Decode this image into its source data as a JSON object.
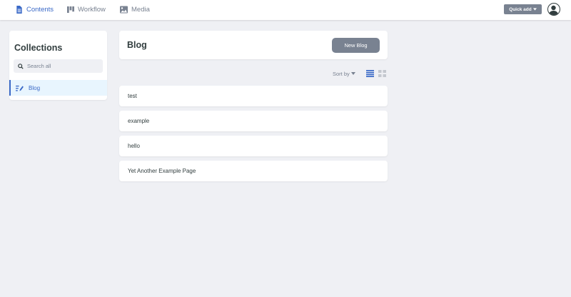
{
  "topbar": {
    "nav": [
      {
        "label": "Contents",
        "icon": "document-icon",
        "active": true
      },
      {
        "label": "Workflow",
        "icon": "kanban-icon",
        "active": false
      },
      {
        "label": "Media",
        "icon": "image-icon",
        "active": false
      }
    ],
    "quick_add_label": "Quick add",
    "avatar_icon": "user-avatar-icon"
  },
  "sidebar": {
    "title": "Collections",
    "search_placeholder": "Search all",
    "collections": [
      {
        "label": "Blog",
        "icon": "edit-list-icon",
        "active": true
      }
    ]
  },
  "main": {
    "title": "Blog",
    "new_button_label": "New Blog",
    "sort_label": "Sort by",
    "entries": [
      {
        "title": "test"
      },
      {
        "title": "example"
      },
      {
        "title": "hello"
      },
      {
        "title": "Yet Another Example Page"
      }
    ]
  },
  "colors": {
    "accent": "#3a69c7",
    "button_gray": "#798291",
    "background": "#eff0f4",
    "text": "#313d3e"
  }
}
